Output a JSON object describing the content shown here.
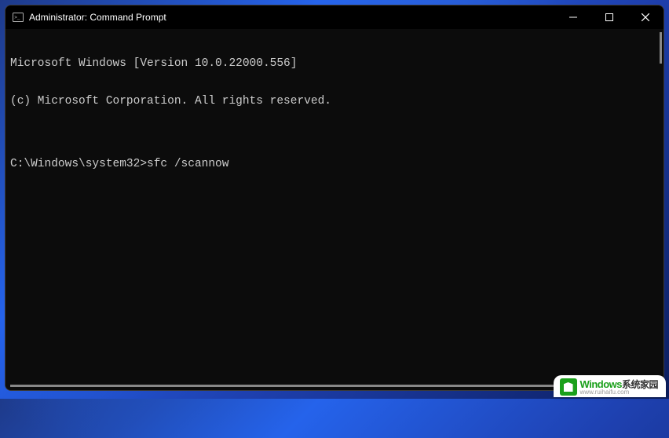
{
  "window": {
    "title": "Administrator: Command Prompt"
  },
  "terminal": {
    "lines": [
      "Microsoft Windows [Version 10.0.22000.556]",
      "(c) Microsoft Corporation. All rights reserved.",
      "",
      "C:\\Windows\\system32>sfc /scannow"
    ]
  },
  "watermark": {
    "brand_prefix": "W",
    "brand_text": "indows",
    "brand_suffix": "系统家园",
    "url": "www.ruihaifu.com"
  }
}
